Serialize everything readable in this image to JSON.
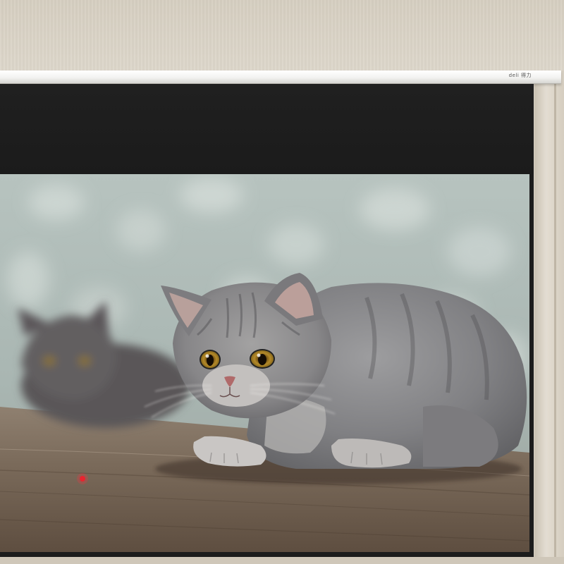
{
  "projector": {
    "brand_logo": "deli 得力"
  },
  "colors": {
    "screen_border": "#1c1c1c",
    "housing": "#f3f3f1",
    "wall": "#d9d2c5",
    "backdrop": "#aebcb7",
    "floor": "#7a6a5b",
    "kitten_fur": "#8a8a8c",
    "laser_dot": "#e0202a"
  },
  "icons": {
    "logo": "brand-logo-icon"
  }
}
